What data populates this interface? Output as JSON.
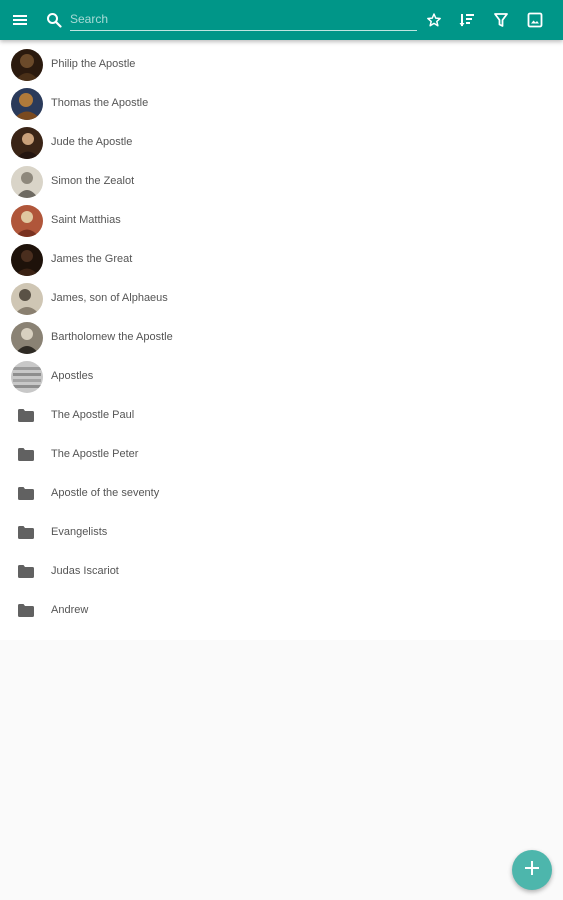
{
  "appbar": {
    "background": "#009688",
    "icons": {
      "menu": "menu-icon",
      "search": "search-icon",
      "favorite": "star-outline-icon",
      "sort": "sort-icon",
      "filter": "filter-icon",
      "image": "image-icon"
    }
  },
  "search": {
    "placeholder": "Search",
    "value": ""
  },
  "list": {
    "items": [
      {
        "label": "Philip the Apostle",
        "kind": "person",
        "avatar_colors": [
          "#6b4a2a",
          "#2b1a0e"
        ]
      },
      {
        "label": "Thomas the Apostle",
        "kind": "person",
        "avatar_colors": [
          "#b07a3a",
          "#2a3a5a"
        ]
      },
      {
        "label": "Jude the Apostle",
        "kind": "person",
        "avatar_colors": [
          "#3a2416",
          "#c9a07a"
        ]
      },
      {
        "label": "Simon the Zealot",
        "kind": "person",
        "avatar_colors": [
          "#d9d4c8",
          "#6e6a62"
        ]
      },
      {
        "label": "Saint Matthias",
        "kind": "person",
        "avatar_colors": [
          "#b0563a",
          "#e0c8a0"
        ]
      },
      {
        "label": "James the Great",
        "kind": "person",
        "avatar_colors": [
          "#4a2e1e",
          "#1e120a"
        ]
      },
      {
        "label": "James, son of Alphaeus",
        "kind": "person",
        "avatar_colors": [
          "#cfc6b4",
          "#5a5246"
        ]
      },
      {
        "label": "Bartholomew the Apostle",
        "kind": "person",
        "avatar_colors": [
          "#8a8274",
          "#2e2a24"
        ]
      },
      {
        "label": "Apostles",
        "kind": "person",
        "avatar_colors": [
          "#c8c8c8",
          "#8e8e8e"
        ]
      },
      {
        "label": "The Apostle Paul",
        "kind": "folder"
      },
      {
        "label": "The Apostle Peter",
        "kind": "folder"
      },
      {
        "label": "Apostle of the seventy",
        "kind": "folder"
      },
      {
        "label": "Evangelists",
        "kind": "folder"
      },
      {
        "label": "Judas Iscariot",
        "kind": "folder"
      },
      {
        "label": "Andrew",
        "kind": "folder"
      }
    ]
  },
  "fab": {
    "icon": "plus-icon",
    "color": "#4db6ac"
  }
}
